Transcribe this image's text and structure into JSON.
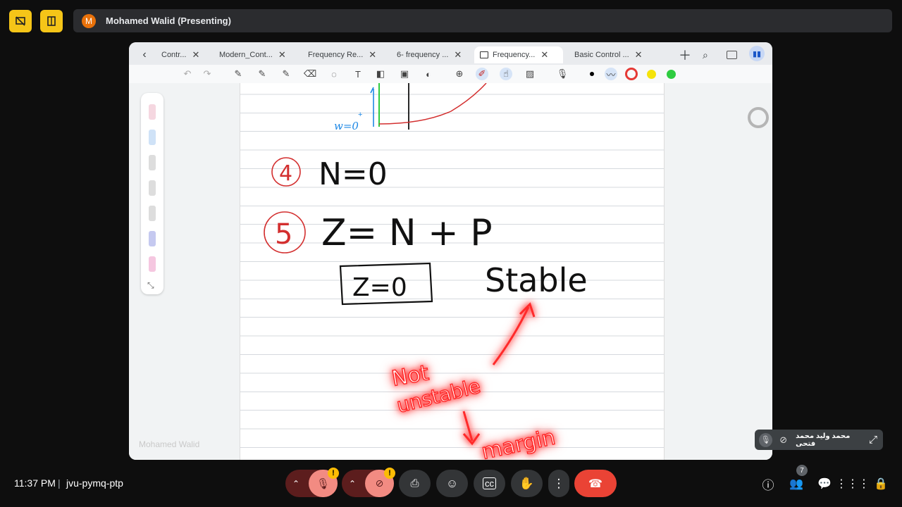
{
  "top": {
    "presenter_initial": "M",
    "presenter_label": "Mohamed Walid (Presenting)"
  },
  "tabs": [
    {
      "label": "Contr..."
    },
    {
      "label": "Modern_Cont..."
    },
    {
      "label": "Frequency Re..."
    },
    {
      "label": "6- frequency ..."
    },
    {
      "label": "Frequency..."
    },
    {
      "label": "Basic Control ..."
    }
  ],
  "colors": {
    "accent": "#f5c518",
    "end_call": "#ea4335",
    "ink_red": "#e53935",
    "ink_blue": "#1e88e5",
    "ink_green": "#2ecc40"
  },
  "whiteboard": {
    "omega_label": "w=0",
    "omega_sup": "+",
    "item4_num": "4",
    "item4_text": "N=0",
    "item5_num": "5",
    "item5_text": "Z= N + P",
    "boxed": "Z=0",
    "stable": "Stable",
    "not_unstable_1": "Not",
    "not_unstable_2": "unstable",
    "margin": "margin"
  },
  "watermark": "Mohamed Walid",
  "self_tile": {
    "name": "محمد وليد محمد فتحى"
  },
  "bottom": {
    "time": "11:37 PM",
    "separator": "|",
    "meeting_code": "jvu-pymq-ptp",
    "participants_count": "7",
    "mic_warning": "!",
    "cam_warning": "!"
  }
}
